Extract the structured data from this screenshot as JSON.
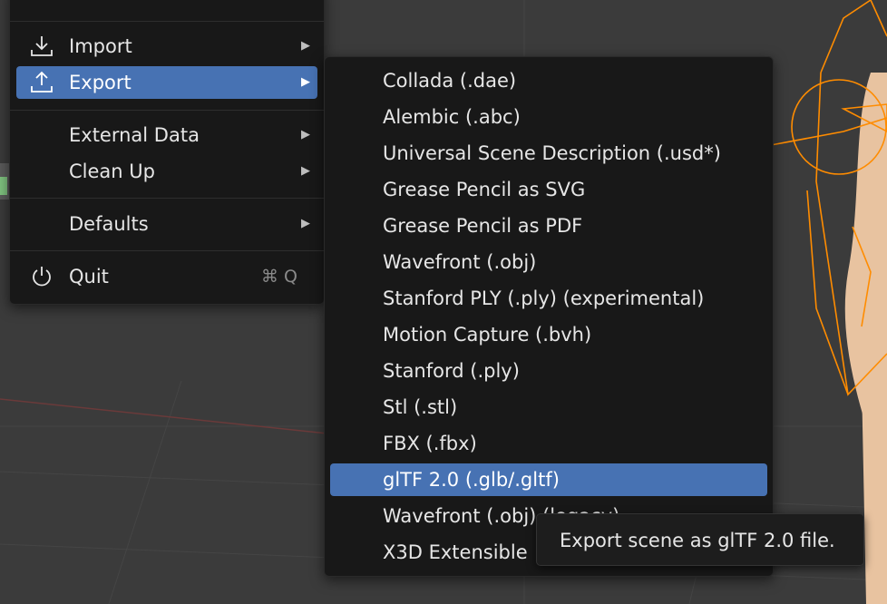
{
  "file_menu": {
    "items": [
      {
        "label": "Import",
        "icon": "import-icon",
        "has_submenu": true
      },
      {
        "label": "Export",
        "icon": "export-icon",
        "has_submenu": true,
        "active": true
      },
      {
        "label": "External Data",
        "has_submenu": true
      },
      {
        "label": "Clean Up",
        "has_submenu": true
      },
      {
        "label": "Defaults",
        "has_submenu": true
      },
      {
        "label": "Quit",
        "icon": "power-icon",
        "shortcut": "⌘ Q"
      }
    ],
    "submenu_arrow": "▶"
  },
  "export_menu": {
    "items": [
      {
        "label": "Collada (.dae)"
      },
      {
        "label": "Alembic (.abc)"
      },
      {
        "label": "Universal Scene Description (.usd*)"
      },
      {
        "label": "Grease Pencil as SVG"
      },
      {
        "label": "Grease Pencil as PDF"
      },
      {
        "label": "Wavefront (.obj)"
      },
      {
        "label": "Stanford PLY (.ply) (experimental)"
      },
      {
        "label": "Motion Capture (.bvh)"
      },
      {
        "label": "Stanford (.ply)"
      },
      {
        "label": "Stl (.stl)"
      },
      {
        "label": "FBX (.fbx)"
      },
      {
        "label": "glTF 2.0 (.glb/.gltf)",
        "active": true
      },
      {
        "label": "Wavefront (.obj) (legacy)"
      },
      {
        "label": "X3D Extensible"
      }
    ]
  },
  "tooltip": {
    "text": "Export scene as glTF 2.0 file."
  },
  "colors": {
    "menu_bg": "#181818",
    "highlight": "#4772b3",
    "text": "#e6e6e6",
    "viewport_bg": "#3b3b3b",
    "armature_orange": "#ff8c00",
    "skin": "#e8c3a0"
  }
}
